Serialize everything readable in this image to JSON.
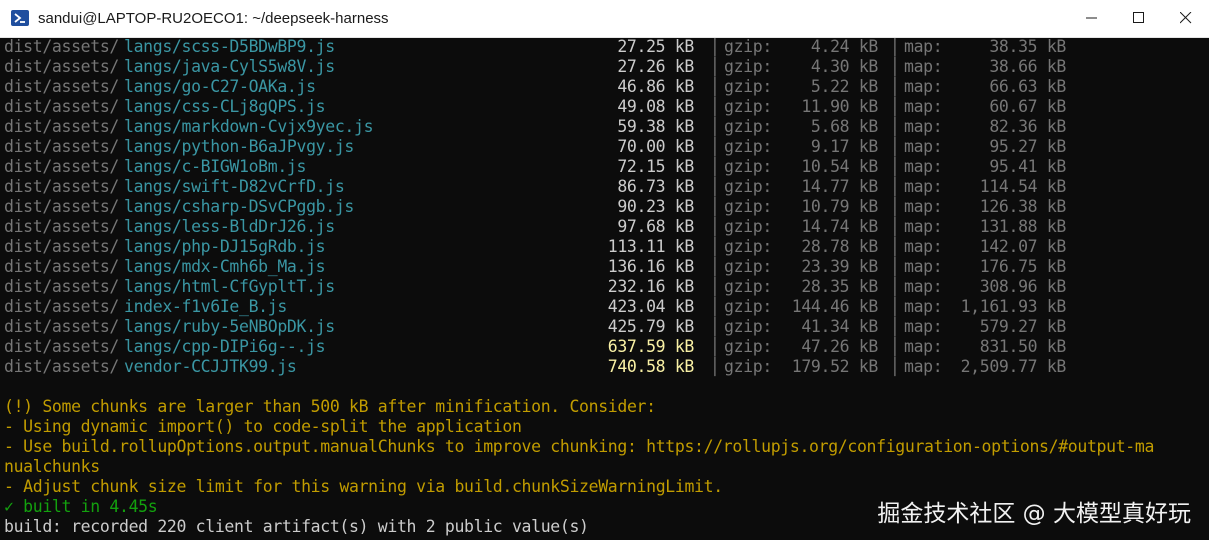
{
  "window": {
    "title": "sandui@LAPTOP-RU2OECO1: ~/deepseek-harness"
  },
  "rows": [
    {
      "prefix": "dist/assets/",
      "file": "langs/scss-D5BDwBP9.js",
      "size": "27.25 kB",
      "gzip": "4.24 kB",
      "map": "38.35 kB",
      "warn": false
    },
    {
      "prefix": "dist/assets/",
      "file": "langs/java-CylS5w8V.js",
      "size": "27.26 kB",
      "gzip": "4.30 kB",
      "map": "38.66 kB",
      "warn": false
    },
    {
      "prefix": "dist/assets/",
      "file": "langs/go-C27-OAKa.js",
      "size": "46.86 kB",
      "gzip": "5.22 kB",
      "map": "66.63 kB",
      "warn": false
    },
    {
      "prefix": "dist/assets/",
      "file": "langs/css-CLj8gQPS.js",
      "size": "49.08 kB",
      "gzip": "11.90 kB",
      "map": "60.67 kB",
      "warn": false
    },
    {
      "prefix": "dist/assets/",
      "file": "langs/markdown-Cvjx9yec.js",
      "size": "59.38 kB",
      "gzip": "5.68 kB",
      "map": "82.36 kB",
      "warn": false
    },
    {
      "prefix": "dist/assets/",
      "file": "langs/python-B6aJPvgy.js",
      "size": "70.00 kB",
      "gzip": "9.17 kB",
      "map": "95.27 kB",
      "warn": false
    },
    {
      "prefix": "dist/assets/",
      "file": "langs/c-BIGW1oBm.js",
      "size": "72.15 kB",
      "gzip": "10.54 kB",
      "map": "95.41 kB",
      "warn": false
    },
    {
      "prefix": "dist/assets/",
      "file": "langs/swift-D82vCrfD.js",
      "size": "86.73 kB",
      "gzip": "14.77 kB",
      "map": "114.54 kB",
      "warn": false
    },
    {
      "prefix": "dist/assets/",
      "file": "langs/csharp-DSvCPggb.js",
      "size": "90.23 kB",
      "gzip": "10.79 kB",
      "map": "126.38 kB",
      "warn": false
    },
    {
      "prefix": "dist/assets/",
      "file": "langs/less-BldDrJ26.js",
      "size": "97.68 kB",
      "gzip": "14.74 kB",
      "map": "131.88 kB",
      "warn": false
    },
    {
      "prefix": "dist/assets/",
      "file": "langs/php-DJ15gRdb.js",
      "size": "113.11 kB",
      "gzip": "28.78 kB",
      "map": "142.07 kB",
      "warn": false
    },
    {
      "prefix": "dist/assets/",
      "file": "langs/mdx-Cmh6b_Ma.js",
      "size": "136.16 kB",
      "gzip": "23.39 kB",
      "map": "176.75 kB",
      "warn": false
    },
    {
      "prefix": "dist/assets/",
      "file": "langs/html-CfGypltT.js",
      "size": "232.16 kB",
      "gzip": "28.35 kB",
      "map": "308.96 kB",
      "warn": false
    },
    {
      "prefix": "dist/assets/",
      "file": "index-f1v6Ie_B.js",
      "size": "423.04 kB",
      "gzip": "144.46 kB",
      "map": "1,161.93 kB",
      "warn": false
    },
    {
      "prefix": "dist/assets/",
      "file": "langs/ruby-5eNBOpDK.js",
      "size": "425.79 kB",
      "gzip": "41.34 kB",
      "map": "579.27 kB",
      "warn": false
    },
    {
      "prefix": "dist/assets/",
      "file": "langs/cpp-DIPi6g--.js",
      "size": "637.59 kB",
      "gzip": "47.26 kB",
      "map": "831.50 kB",
      "warn": true
    },
    {
      "prefix": "dist/assets/",
      "file": "vendor-CCJJTK99.js",
      "size": "740.58 kB",
      "gzip": "179.52 kB",
      "map": "2,509.77 kB",
      "warn": true
    }
  ],
  "labels": {
    "gzip": "gzip:",
    "map": "map:",
    "sep": "│"
  },
  "messages": {
    "warning": "(!) Some chunks are larger than 500 kB after minification. Consider:",
    "tip1": "- Using dynamic import() to code-split the application",
    "tip2a": "- Use build.rollupOptions.output.manualChunks to improve chunking: https://rollupjs.org/configuration-options/#output-ma",
    "tip2b": "nualchunks",
    "tip3": "- Adjust chunk size limit for this warning via build.chunkSizeWarningLimit.",
    "built": "✓ built in 4.45s",
    "recorded": "build: recorded 220 client artifact(s) with 2 public value(s)"
  },
  "watermark": "掘金技术社区 @ 大模型真好玩",
  "colors": {
    "path_dim": "#767676",
    "path_cyan": "#3a96a3",
    "size_normal": "#cccccc",
    "size_warn": "#f9f1a5",
    "warning_text": "#c19c00",
    "success": "#13a10e"
  }
}
